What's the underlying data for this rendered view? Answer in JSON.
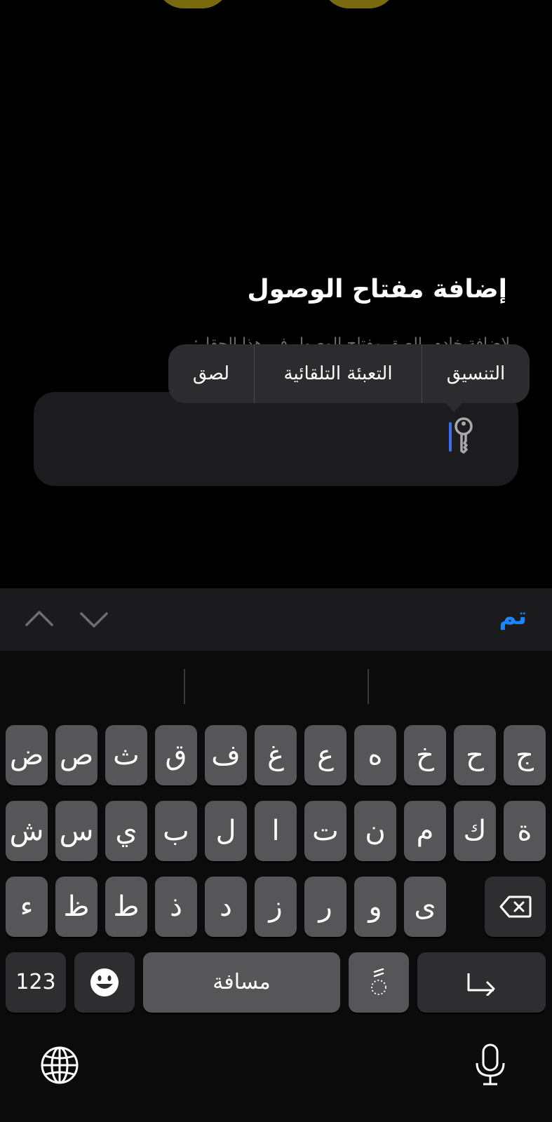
{
  "page": {
    "title": "إضافة مفتاح الوصول",
    "subtitle": "لإضافة خادم، الصق مفتاح الوصول في هذا الحقل:"
  },
  "input": {
    "value": "",
    "icon": "key-icon"
  },
  "context_menu": {
    "paste": "لصق",
    "autofill": "التعبئة التلقائية",
    "format": "التنسيق"
  },
  "toolbar": {
    "prev_icon": "chevron-up-icon",
    "next_icon": "chevron-down-icon",
    "done": "تم"
  },
  "keyboard": {
    "row1": [
      "ض",
      "ص",
      "ث",
      "ق",
      "ف",
      "غ",
      "ع",
      "ه",
      "خ",
      "ح",
      "ج"
    ],
    "row2": [
      "ش",
      "س",
      "ي",
      "ب",
      "ل",
      "ا",
      "ت",
      "ن",
      "م",
      "ك",
      "ة"
    ],
    "row3": [
      "ء",
      "ظ",
      "ط",
      "ذ",
      "د",
      "ز",
      "ر",
      "و",
      "ى"
    ],
    "numbers": "123",
    "space": "مسافة",
    "diacritic": "ً",
    "icons": {
      "delete": "backspace-icon",
      "emoji": "emoji-icon",
      "return": "return-icon",
      "globe": "globe-icon",
      "mic": "microphone-icon"
    }
  }
}
